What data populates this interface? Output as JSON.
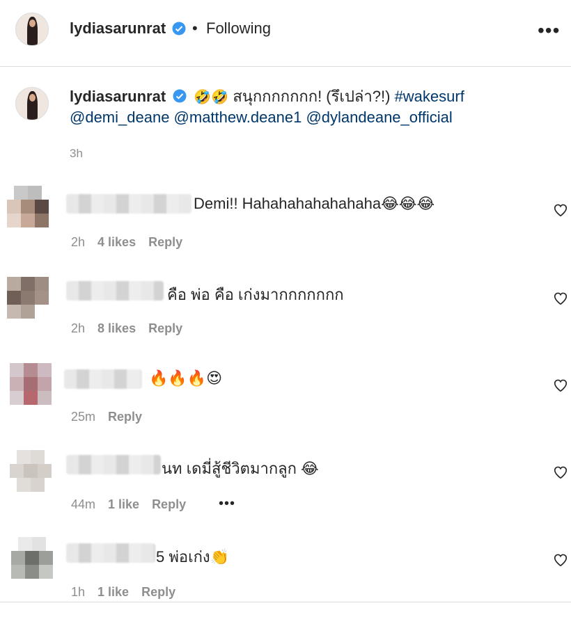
{
  "header": {
    "username": "lydiasarunrat",
    "separator": "•",
    "follow_status": "Following",
    "more_label": "•••"
  },
  "caption": {
    "username": "lydiasarunrat",
    "emojis": "🤣🤣",
    "text": "สนุกกกกกกก! (รึเปล่า?!)",
    "hashtag": "#wakesurf",
    "mentions": "@demi_deane @matthew.deane1 @dylandeane_official",
    "time": "3h"
  },
  "comments": [
    {
      "text": "Demi!! Hahahahahahahaha😂😂😂",
      "time": "2h",
      "likes": "4 likes",
      "reply": "Reply"
    },
    {
      "text": "คือ พ่อ คือ เก่งมากกกกกกก",
      "time": "2h",
      "likes": "8 likes",
      "reply": "Reply"
    },
    {
      "text": "🔥🔥🔥😍",
      "time": "25m",
      "likes": "",
      "reply": "Reply"
    },
    {
      "text": "นท เดมี่สู้ชีวิตมากลูก 😂",
      "time": "44m",
      "likes": "1 like",
      "reply": "Reply",
      "more": "•••"
    },
    {
      "text": "5 พ่อเก่ง👏",
      "time": "1h",
      "likes": "1 like",
      "reply": "Reply"
    }
  ],
  "colors": {
    "link": "#00376b",
    "verified": "#3897f0",
    "muted": "#8e8e8e",
    "text": "#262626"
  }
}
